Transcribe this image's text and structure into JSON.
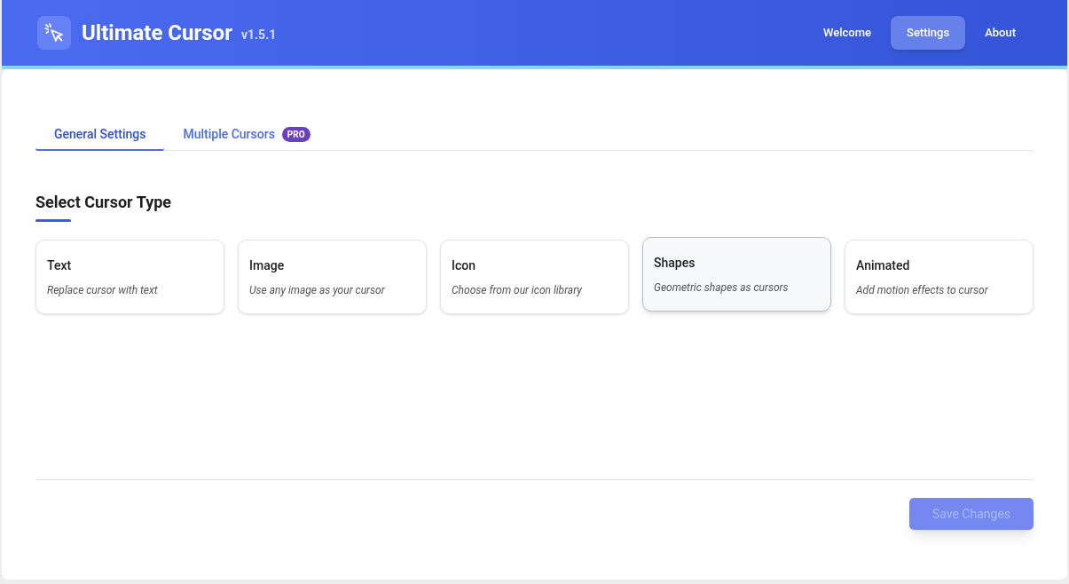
{
  "app": {
    "title": "Ultimate Cursor",
    "version": "v1.5.1"
  },
  "nav": [
    {
      "label": "Welcome",
      "selected": false
    },
    {
      "label": "Settings",
      "selected": true
    },
    {
      "label": "About",
      "selected": false
    }
  ],
  "tabs": [
    {
      "label": "General Settings",
      "selected": true
    },
    {
      "label": "Multiple Cursors",
      "selected": false,
      "badge": "PRO"
    }
  ],
  "section": {
    "title": "Select Cursor Type"
  },
  "cursor_types": [
    {
      "title": "Text",
      "description": "Replace cursor with text",
      "selected": false
    },
    {
      "title": "Image",
      "description": "Use any image as your cursor",
      "selected": false
    },
    {
      "title": "Icon",
      "description": "Choose from our icon library",
      "selected": false
    },
    {
      "title": "Shapes",
      "description": "Geometric shapes as cursors",
      "selected": true
    },
    {
      "title": "Animated",
      "description": "Add motion effects to cursor",
      "selected": false
    }
  ],
  "save_button": {
    "label": "Save Changes",
    "disabled": true
  }
}
